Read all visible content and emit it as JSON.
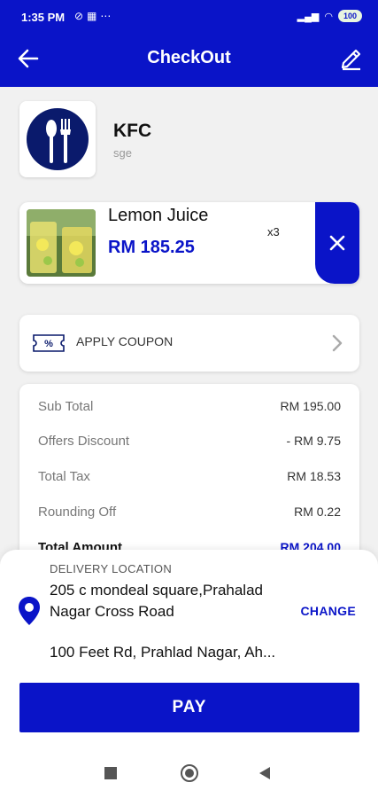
{
  "status_bar": {
    "time": "1:35 PM",
    "battery": "100"
  },
  "header": {
    "title": "CheckOut"
  },
  "store": {
    "name": "KFC",
    "subtitle": "sge"
  },
  "cart_item": {
    "name": "Lemon Juice",
    "price": "RM 185.25",
    "quantity": "x3"
  },
  "coupon": {
    "label": "APPLY COUPON",
    "icon_text": "%"
  },
  "summary": {
    "rows": [
      {
        "label": "Sub Total",
        "value": "RM 195.00"
      },
      {
        "label": "Offers Discount",
        "value": "- RM 9.75"
      },
      {
        "label": "Total Tax",
        "value": "RM 18.53"
      },
      {
        "label": "Rounding Off",
        "value": "RM 0.22"
      },
      {
        "label": "Total Amount",
        "value": "RM 204.00"
      }
    ]
  },
  "delivery": {
    "label": "DELIVERY LOCATION",
    "address_line1": "205 c mondeal square,Prahalad Nagar Cross Road",
    "address_line2": "100 Feet Rd, Prahlad Nagar, Ah...",
    "change_label": "CHANGE"
  },
  "pay_button": {
    "label": "PAY"
  },
  "colors": {
    "primary": "#0a14c8",
    "background": "#f1f1f1"
  }
}
